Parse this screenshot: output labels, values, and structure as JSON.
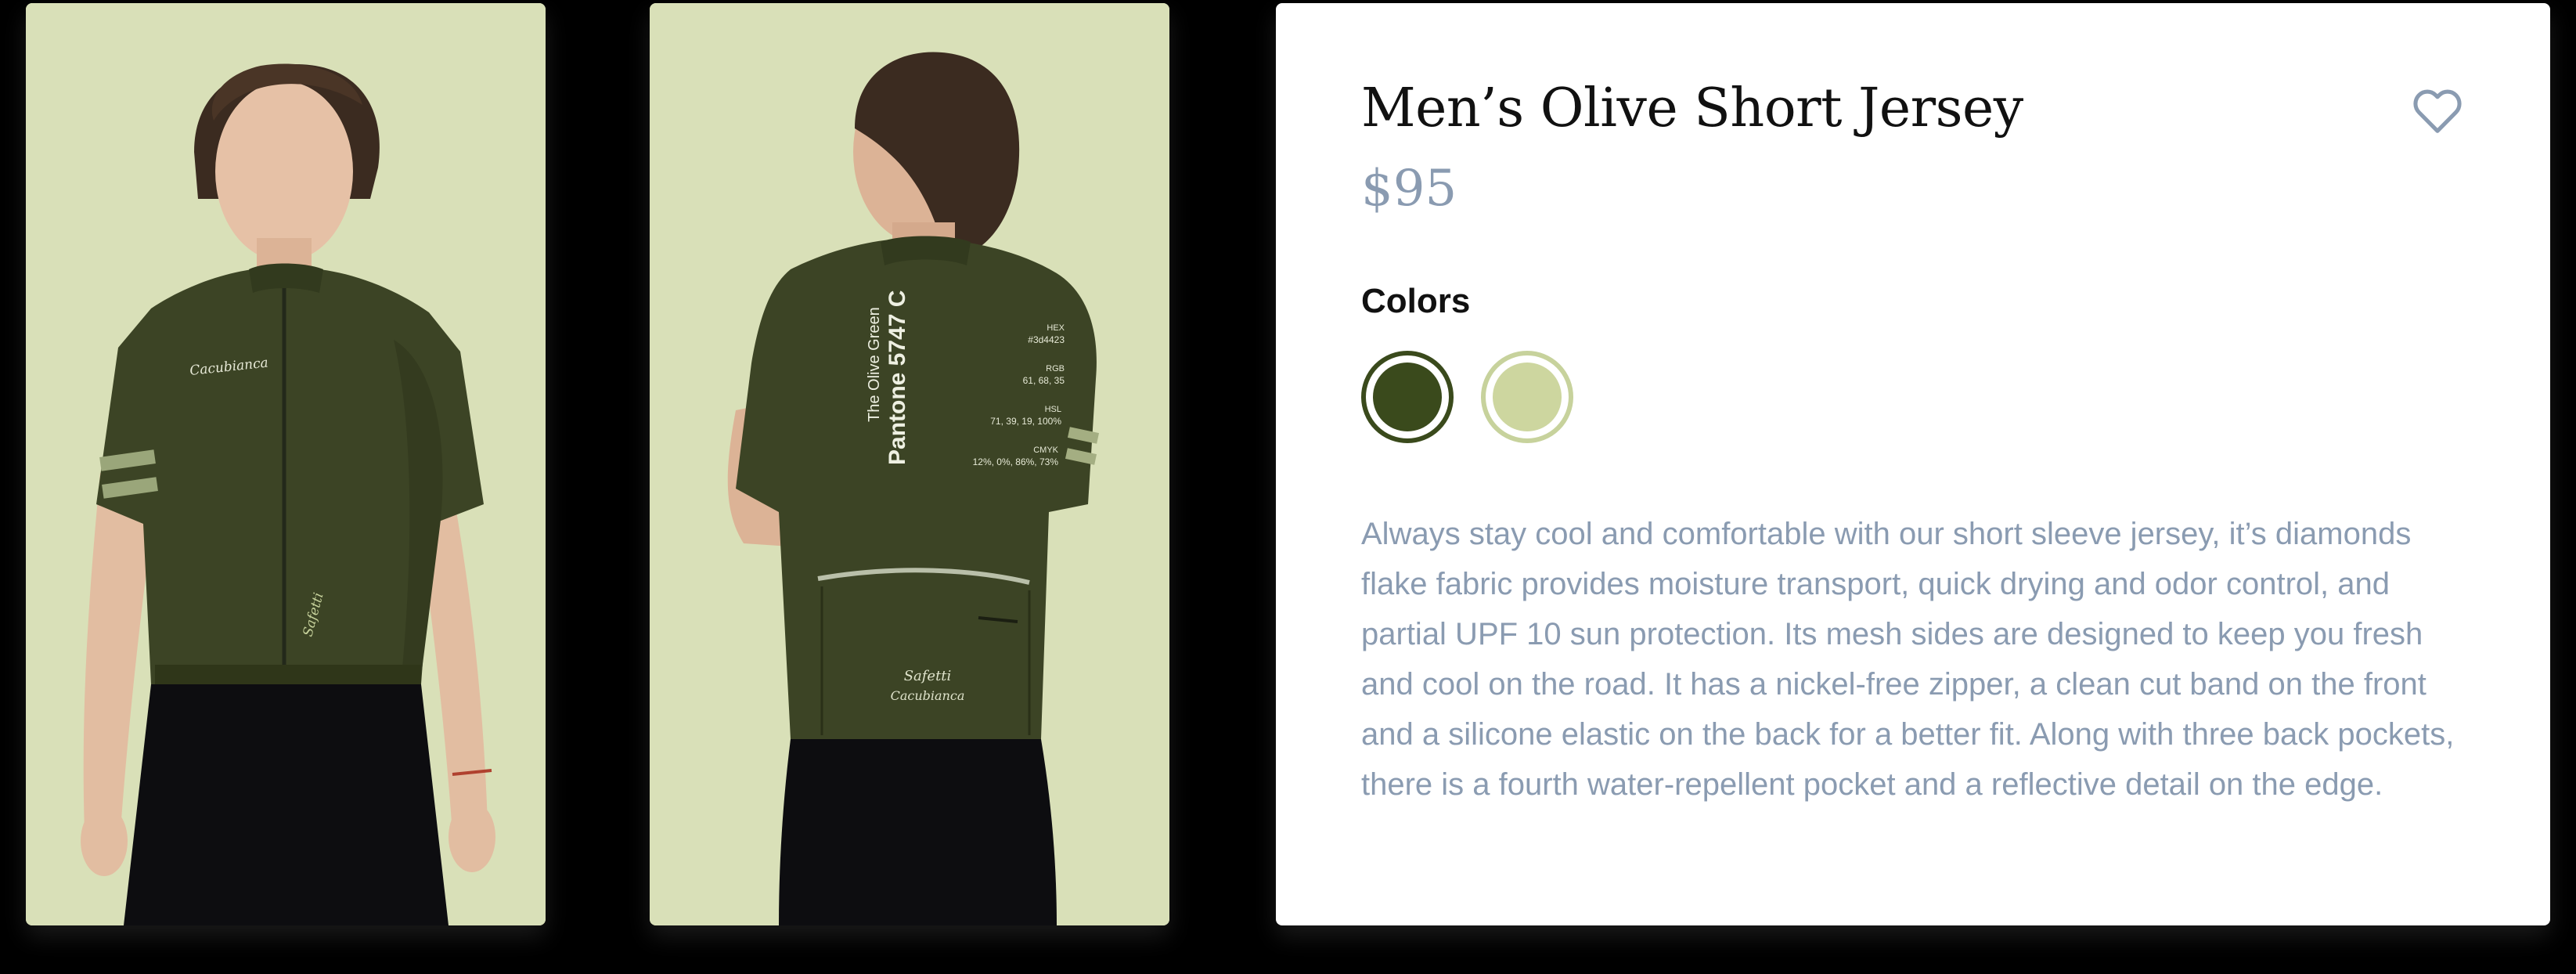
{
  "product": {
    "title": "Men’s Olive Short Jersey",
    "price": "$95",
    "colors_label": "Colors",
    "colors": [
      {
        "name": "olive",
        "hex": "#3a4a1c",
        "selected": true
      },
      {
        "name": "sage",
        "hex": "#cdd69f",
        "selected": false
      }
    ],
    "description": "Always stay cool and comfortable with our short sleeve jersey, it’s diamonds flake fabric provides moisture transport, quick drying and odor control, and partial UPF 10 sun protection. Its mesh sides are designed to keep you fresh and cool on the road. It has a nickel-free zipper, a clean cut band on the front and a silicone elastic on the back for a better fit. Along with three back pockets, there is a fourth water-repellent pocket and a reflective detail on the edge.",
    "favorite_icon": "heart-icon"
  },
  "photos": {
    "background_hex": "#d9e0b8",
    "front": {
      "chest_text": "Cacubianca",
      "hem_text": "Safetti"
    },
    "back": {
      "vertical_line1": "The Olive Green",
      "vertical_line2": "Pantone 5747 C",
      "hex_label": "HEX",
      "hex_value": "#3d4423",
      "rgb_label": "RGB",
      "rgb_value": "61, 68, 35",
      "hsl_label": "HSL",
      "hsl_value": "71, 39, 19, 100%",
      "cmyk_label": "CMYK",
      "cmyk_value": "12%, 0%, 86%, 73%",
      "pocket_text1": "Safetti",
      "pocket_text2": "Cacubianca"
    }
  }
}
